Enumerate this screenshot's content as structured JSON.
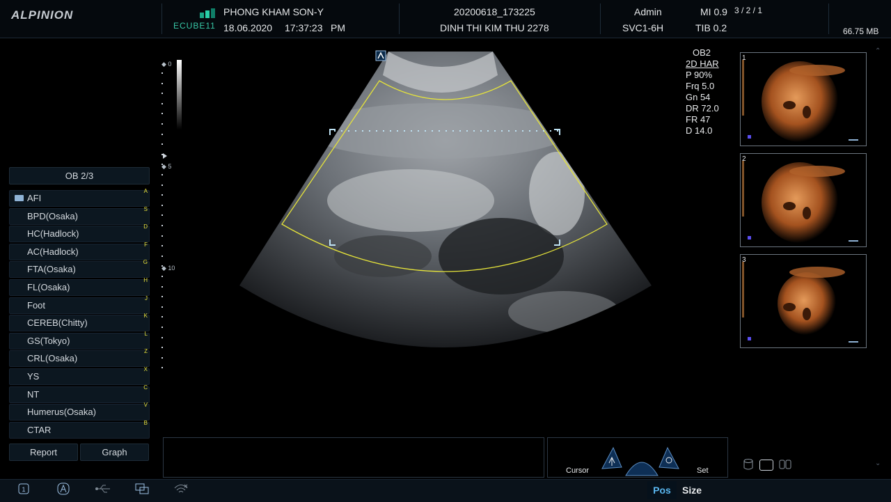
{
  "header": {
    "logo": "ALPINION",
    "ecube": "ECUBE11",
    "clinic": "PHONG KHAM SON-Y",
    "date": "18.06.2020",
    "time": "17:37:23",
    "ampm": "PM",
    "study_id": "20200618_173225",
    "patient": "DINH THI  KIM THU 2278",
    "user": "Admin",
    "probe": "SVC1-6H",
    "mi": "MI 0.9",
    "tib": "TIB 0.2",
    "frame": "3 / 2 / 1",
    "storage": "66.75 MB"
  },
  "left_panel": {
    "title": "OB 2/3",
    "measurements": [
      {
        "label": "AFI",
        "key": "A",
        "folder": true
      },
      {
        "label": "BPD(Osaka)",
        "key": "S"
      },
      {
        "label": "HC(Hadlock)",
        "key": "D"
      },
      {
        "label": "AC(Hadlock)",
        "key": "F"
      },
      {
        "label": "FTA(Osaka)",
        "key": "G"
      },
      {
        "label": "FL(Osaka)",
        "key": "H"
      },
      {
        "label": "Foot",
        "key": "J"
      },
      {
        "label": "CEREB(Chitty)",
        "key": "K"
      },
      {
        "label": "GS(Tokyo)",
        "key": "L"
      },
      {
        "label": "CRL(Osaka)",
        "key": "Z"
      },
      {
        "label": "YS",
        "key": "X"
      },
      {
        "label": "NT",
        "key": "C"
      },
      {
        "label": "Humerus(Osaka)",
        "key": "V"
      },
      {
        "label": "CTAR",
        "key": "B"
      }
    ],
    "report_label": "Report",
    "graph_label": "Graph"
  },
  "scale": {
    "depth_0": "0",
    "depth_5": "5",
    "depth_10": "10"
  },
  "params": {
    "preset": "OB2",
    "mode": "2D HAR",
    "power": "P 90%",
    "freq": "Frq 5.0",
    "gain": "Gn 54",
    "dr": "DR 72.0",
    "fr": "FR 47",
    "depth": "D 14.0"
  },
  "thumbnails": [
    {
      "num": "1"
    },
    {
      "num": "2"
    },
    {
      "num": "3"
    }
  ],
  "controls": {
    "cursor_label": "Cursor",
    "set_label": "Set"
  },
  "statusbar": {
    "pos_label": "Pos",
    "size_label": "Size",
    "icon_1": "1"
  },
  "colors": {
    "roi": "#e6e43a",
    "accent": "#5ab7f0",
    "key": "#e7e23c"
  },
  "icons": [
    "probe-1-icon",
    "annotation-a-icon",
    "usb-icon",
    "network-icon",
    "wifi-icon",
    "database-icon",
    "monitor-icon",
    "split-icon",
    "cursor-arrow-icon",
    "set-target-icon"
  ]
}
